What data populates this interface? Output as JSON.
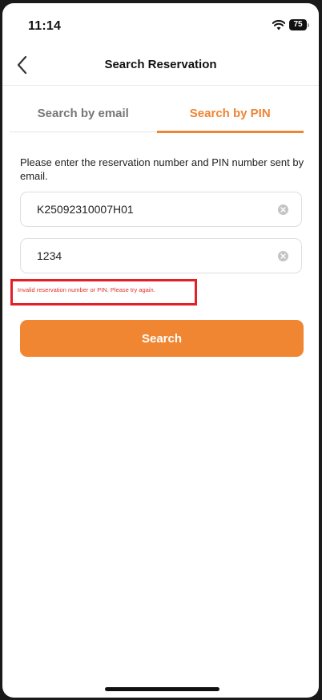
{
  "status_bar": {
    "time": "11:14",
    "battery_level": "75",
    "icons": [
      "wifi-icon",
      "battery-icon"
    ]
  },
  "nav": {
    "title": "Search Reservation",
    "back_icon": "chevron-left-icon"
  },
  "tabs": [
    {
      "label": "Search by email",
      "active": false
    },
    {
      "label": "Search by PIN",
      "active": true
    }
  ],
  "form": {
    "instructions": "Please enter the reservation number and PIN number sent by email.",
    "reservation_number": "K25092310007H01",
    "pin": "1234",
    "clear_icon": "clear-circle-icon",
    "error": "Invalid reservation number or PIN. Please try again.",
    "submit_label": "Search"
  },
  "colors": {
    "accent": "#f08432",
    "error": "#e0322d",
    "highlight_box": "#e32027"
  }
}
